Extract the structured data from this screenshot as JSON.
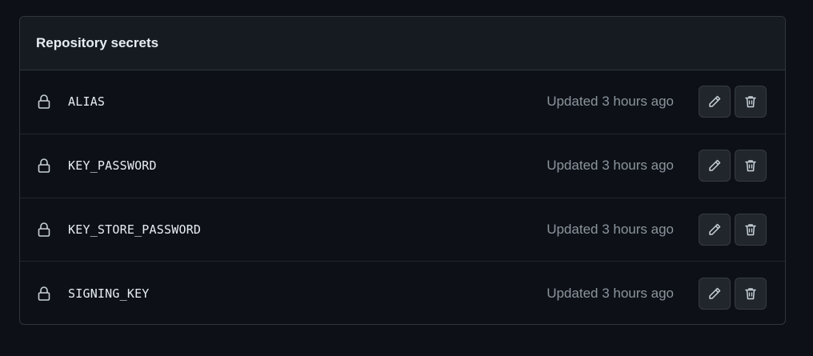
{
  "panel": {
    "title": "Repository secrets"
  },
  "secrets": [
    {
      "name": "ALIAS",
      "updated": "Updated 3 hours ago"
    },
    {
      "name": "KEY_PASSWORD",
      "updated": "Updated 3 hours ago"
    },
    {
      "name": "KEY_STORE_PASSWORD",
      "updated": "Updated 3 hours ago"
    },
    {
      "name": "SIGNING_KEY",
      "updated": "Updated 3 hours ago"
    }
  ],
  "icons": {
    "lock": "lock-icon",
    "edit": "pencil-icon",
    "delete": "trash-icon"
  },
  "colors": {
    "background": "#0d1117",
    "header_background": "#161b22",
    "border": "#30363d",
    "text_primary": "#e6edf3",
    "text_muted": "#8b949e",
    "button_background": "#21262d"
  }
}
